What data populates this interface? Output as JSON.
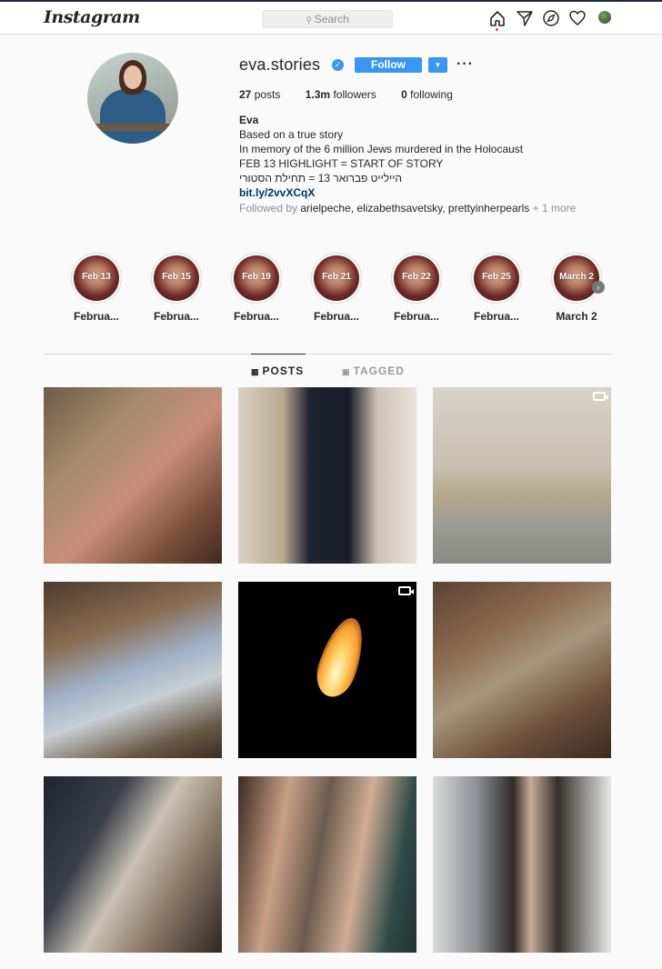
{
  "nav": {
    "logo": "Instagram",
    "search_placeholder": "Search",
    "icons": [
      "home-icon",
      "direct-icon",
      "explore-icon",
      "activity-heart-icon",
      "profile-avatar"
    ]
  },
  "profile": {
    "username": "eva.stories",
    "verified": true,
    "follow_label": "Follow",
    "stats": {
      "posts_count": "27",
      "posts_label": "posts",
      "followers_count": "1.3m",
      "followers_label": "followers",
      "following_count": "0",
      "following_label": "following"
    },
    "bio": {
      "name": "Eva",
      "lines": [
        "Based on a true story",
        "In memory of the 6 million Jews murdered in the Holocaust",
        "FEB 13 HIGHLIGHT = START OF STORY",
        "היילייט פברואר 13 = תחילת הסטורי"
      ],
      "link": "bit.ly/2vvXCqX"
    },
    "followed_by": {
      "prefix": "Followed by",
      "names": "arielpeche, elizabethsavetsky, prettyinherpearls",
      "suffix": "+ 1 more"
    }
  },
  "highlights": [
    {
      "cover": "Feb 13",
      "caption": "Februa..."
    },
    {
      "cover": "Feb 15",
      "caption": "Februa..."
    },
    {
      "cover": "Feb 19",
      "caption": "Februa..."
    },
    {
      "cover": "Feb 21",
      "caption": "Februa..."
    },
    {
      "cover": "Feb 22",
      "caption": "Februa..."
    },
    {
      "cover": "Feb 25",
      "caption": "Februa..."
    },
    {
      "cover": "March 2",
      "caption": "March 2"
    }
  ],
  "tabs": {
    "posts": "POSTS",
    "tagged": "TAGGED"
  },
  "colors": {
    "accent": "#3897f0",
    "link": "#003569",
    "text": "#262626",
    "muted": "#8e8e8e",
    "notification_dot": "#ed4956"
  }
}
